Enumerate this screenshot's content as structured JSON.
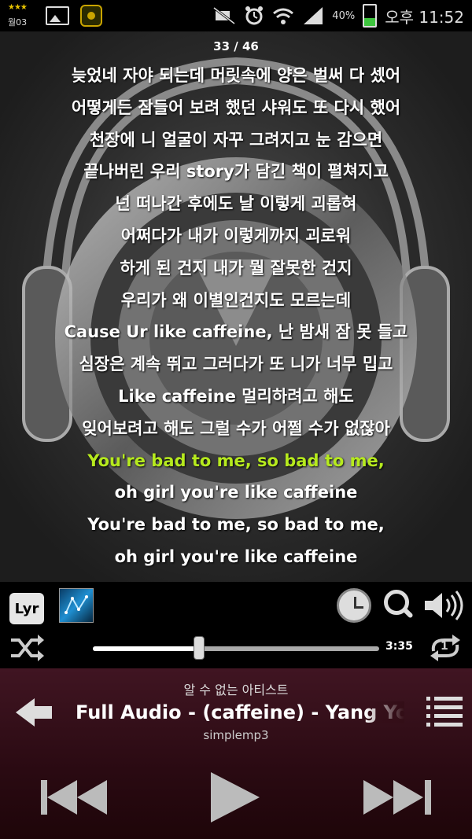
{
  "status_bar": {
    "calendar_label": "월03",
    "battery_percent_text": "40%",
    "battery_level": 0.4,
    "time": "오후 11:52",
    "icons": [
      "calendar-icon",
      "picture-icon",
      "app-icon",
      "mute-icon",
      "alarm-icon",
      "wifi-icon",
      "signal-icon",
      "battery-icon"
    ]
  },
  "lyrics": {
    "counter": "33 / 46",
    "active_index": 12,
    "lines": [
      "늦었네 자야 되는데 머릿속에 양은 벌써 다 셌어",
      "어떻게든 잠들어 보려 했던 샤워도 또 다시 했어",
      "천장에 니 얼굴이 자꾸 그려지고 눈 감으면",
      "끝나버린 우리 story가 담긴 책이 펼쳐지고",
      "넌 떠나간 후에도 날 이렇게 괴롭혀",
      "어쩌다가 내가 이렇게까지 괴로워",
      "하게 된 건지 내가 뭘 잘못한 건지",
      "우리가 왜 이별인건지도 모르는데",
      "Cause Ur like caffeine, 난 밤새 잠 못 들고",
      "심장은 계속 뛰고 그러다가 또 니가 너무 밉고",
      "Like caffeine 멀리하려고 해도",
      "잊어보려고 해도 그럴 수가 어쩔 수가 없잖아",
      "You're bad to me, so bad to me,",
      "oh girl you're like caffeine",
      "You're bad to me, so bad to me,",
      "oh girl you're like caffeine",
      "···"
    ]
  },
  "controls": {
    "lyr_label": "Lyr",
    "total_time": "3:35",
    "progress": 0.37,
    "repeat_count": "1"
  },
  "now_playing": {
    "artist": "알 수 없는 아티스트",
    "title": "Full Audio  -  (caffeine) - Yang Yo",
    "album": "simplemp3"
  }
}
